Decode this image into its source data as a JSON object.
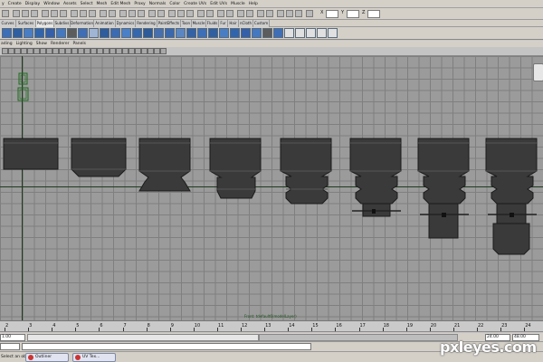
{
  "menu": [
    "y",
    "Create",
    "Display",
    "Window",
    "Assets",
    "Select",
    "Mesh",
    "Edit Mesh",
    "Proxy",
    "Normals",
    "Color",
    "Create UVs",
    "Edit UVs",
    "Muscle",
    "Help"
  ],
  "status_line": {
    "x_label": "X",
    "y_label": "Y",
    "z_label": "Z"
  },
  "shelf_tabs": [
    "Curves",
    "Surfaces",
    "Polygons",
    "Subdivs",
    "Deformation",
    "Animation",
    "Dynamics",
    "Rendering",
    "PaintEffects",
    "Toon",
    "Muscle",
    "Fluids",
    "Fur",
    "Hair",
    "nCloth",
    "Custom"
  ],
  "active_shelf_tab": "Polygons",
  "panel_menus": [
    "ading",
    "Lighting",
    "Show",
    "Renderer",
    "Panels"
  ],
  "viewport": {
    "hud_caption": "Front: tdefault6(modelLayer)",
    "background_color": "#9b9b9b",
    "grid_color": "#7f7f7f",
    "axis_color": "#1e3a1e",
    "model_color": "#3a3a3a"
  },
  "timeslider": {
    "ticks": [
      "2",
      "3",
      "4",
      "5",
      "6",
      "7",
      "8",
      "9",
      "10",
      "11",
      "12",
      "13",
      "14",
      "15",
      "16",
      "17",
      "18",
      "19",
      "20",
      "21",
      "22",
      "23",
      "24"
    ]
  },
  "range": {
    "start": "1.00",
    "end1": "24.00",
    "end2": "48.00"
  },
  "help_line": "Select an object",
  "taskbar": [
    {
      "label": "Outliner",
      "icon": "maya-icon"
    },
    {
      "label": "UV Tex...",
      "icon": "maya-icon"
    }
  ],
  "watermark": "pxleyes.com"
}
